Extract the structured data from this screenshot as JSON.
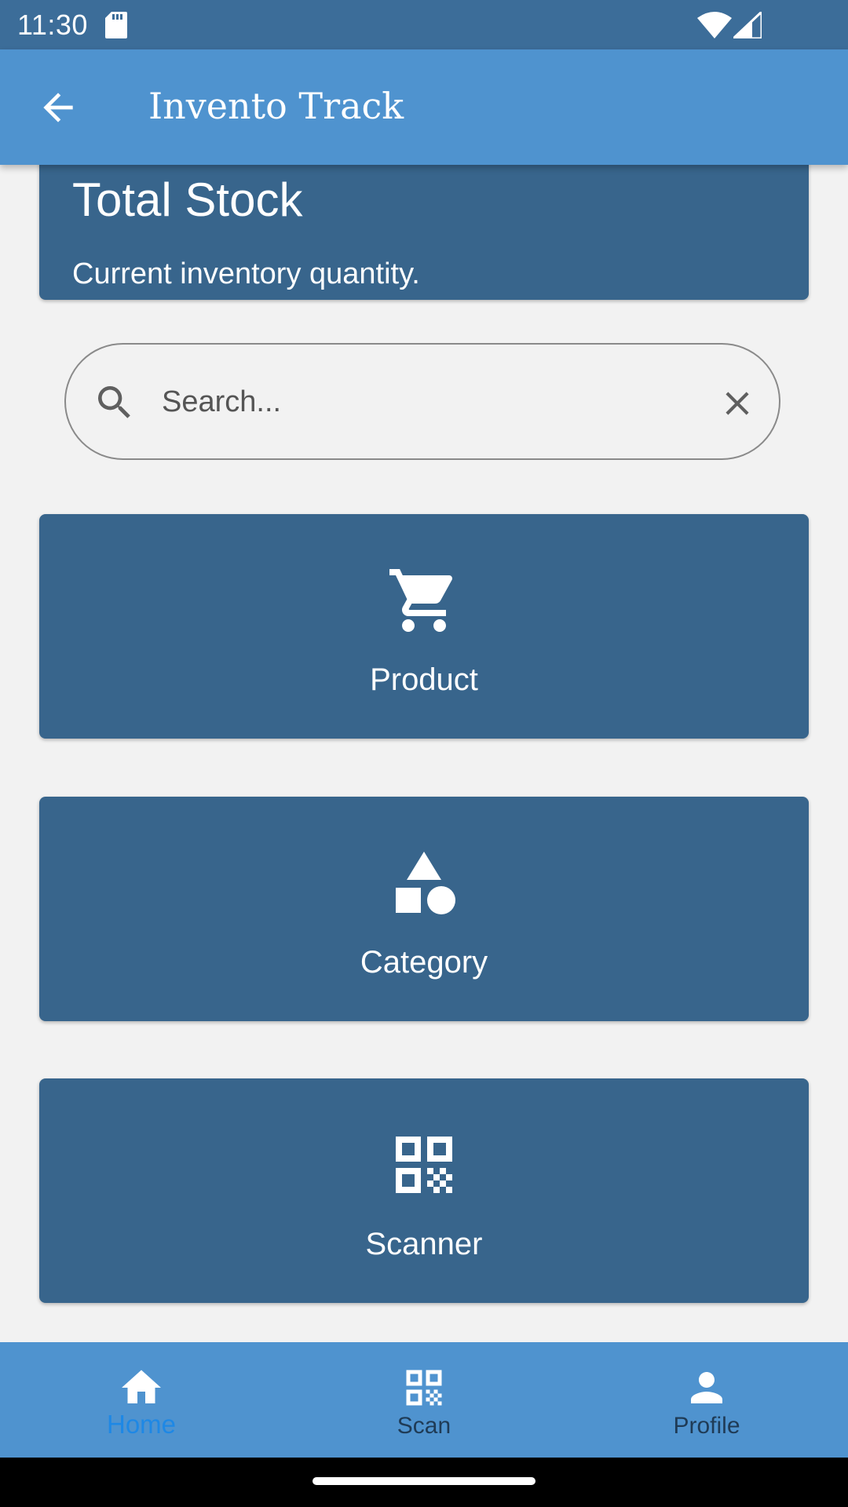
{
  "status_bar": {
    "time": "11:30"
  },
  "app_bar": {
    "title": "Invento Track",
    "back_icon": "arrow-back-icon"
  },
  "stock_card": {
    "title": "Total Stock",
    "subtitle": "Current inventory quantity."
  },
  "search": {
    "placeholder": "Search...",
    "value": ""
  },
  "tiles": [
    {
      "label": "Product",
      "icon": "cart-icon"
    },
    {
      "label": "Category",
      "icon": "category-icon"
    },
    {
      "label": "Scanner",
      "icon": "qr-code-icon"
    }
  ],
  "bottom_nav": {
    "items": [
      {
        "label": "Home",
        "icon": "home-icon",
        "active": true
      },
      {
        "label": "Scan",
        "icon": "qr-code-icon",
        "active": false
      },
      {
        "label": "Profile",
        "icon": "person-icon",
        "active": false
      }
    ]
  },
  "colors": {
    "status_bar": "#3c6d99",
    "app_bar": "#4f93cf",
    "card": "#38658c",
    "background": "#f2f2f2",
    "active_nav": "#1e88e5"
  }
}
